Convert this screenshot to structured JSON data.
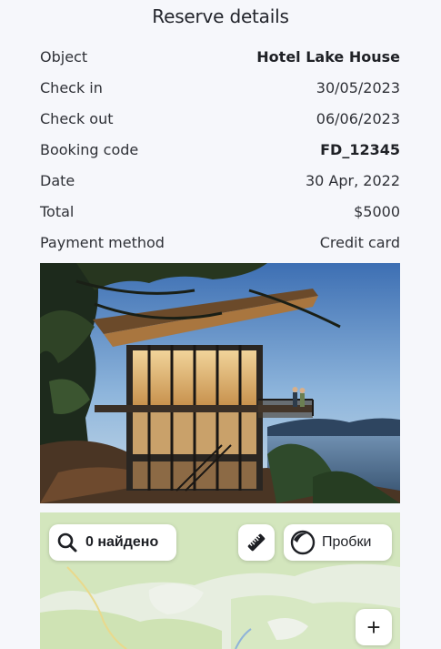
{
  "page": {
    "title": "Reserve details"
  },
  "details": [
    {
      "label": "Object",
      "value": "Hotel Lake House",
      "bold": true
    },
    {
      "label": "Check in",
      "value": "30/05/2023",
      "bold": false
    },
    {
      "label": "Check out",
      "value": "06/06/2023",
      "bold": false
    },
    {
      "label": "Booking code",
      "value": "FD_12345",
      "bold": true
    },
    {
      "label": "Date",
      "value": "30 Apr, 2022",
      "bold": false
    },
    {
      "label": "Total",
      "value": "$5000",
      "bold": false
    },
    {
      "label": "Payment method",
      "value": "Credit card",
      "bold": false
    }
  ],
  "photo": {
    "icon": "hotel-photo"
  },
  "map": {
    "search_label": "0 найдено",
    "traffic_label": "Пробки",
    "zoom_in_label": "+",
    "icons": [
      "search-icon",
      "ruler-icon",
      "traffic-icon"
    ]
  },
  "colors": {
    "background": "#f6f7fb",
    "text": "#2f3137",
    "map_green": "#cfe3b4",
    "map_button": "#ffffff"
  }
}
